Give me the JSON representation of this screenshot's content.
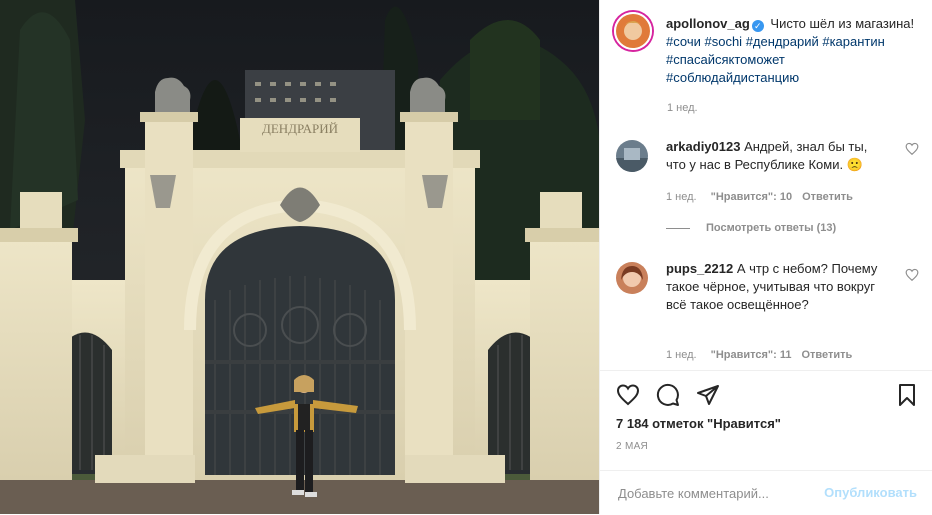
{
  "post": {
    "username": "apollonov_ag",
    "verified_mark": "✓",
    "caption_text": "Чисто шёл из магазина!",
    "hashtags": [
      "#сочи",
      "#sochi",
      "#дендрарий",
      "#карантин",
      "#спасайсяктоможет",
      "#соблюдайдистанцию"
    ],
    "time": "1 нед.",
    "sign_text": "ДЕНДРАРИЙ"
  },
  "comments": [
    {
      "username": "arkadiy0123",
      "text": "Андрей, знал бы ты, что у нас в Республике Коми. 🙁",
      "time": "1 нед.",
      "likes": "\"Нравится\": 10",
      "reply": "Ответить",
      "view_replies": "Посмотреть ответы (13)"
    },
    {
      "username": "pups_2212",
      "text": "А чтр с небом? Почему такое чёрное, учитывая что вокруг всё такое освещённое?",
      "time": "1 нед.",
      "likes": "\"Нравится\": 11",
      "reply": "Ответить"
    }
  ],
  "actions": {
    "icons": [
      "heart-icon",
      "comment-icon",
      "share-icon",
      "bookmark-icon"
    ],
    "likes_text": "7 184 отметок \"Нравится\"",
    "date": "2 МАЯ"
  },
  "add_comment": {
    "placeholder": "Добавьте комментарий...",
    "publish_label": "Опубликовать"
  },
  "colors": {
    "link": "#00376b",
    "muted": "#8e8e8e",
    "publish_disabled": "#b2dffc",
    "verified": "#3897f0",
    "night_sky": "#1c2024",
    "facade": "#e8dfc0"
  }
}
